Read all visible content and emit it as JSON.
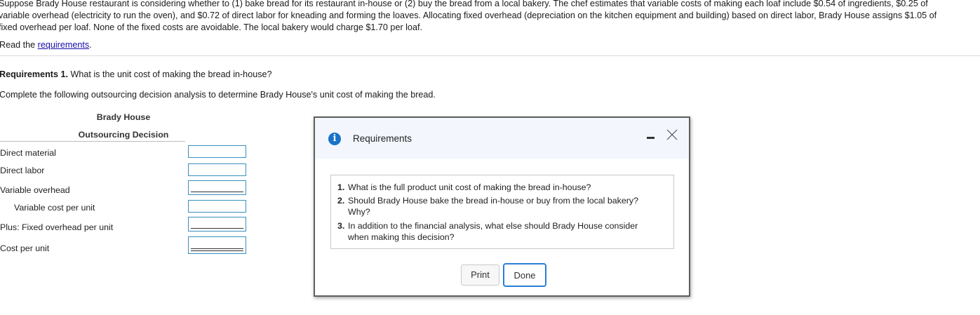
{
  "problem": {
    "line1": "Suppose Brady House restaurant is considering whether to (1) bake bread for its restaurant in-house or (2) buy the bread from a local bakery. The chef estimates that variable costs of making each loaf include $0.54 of ingredients, $0.25 of",
    "line2": "variable overhead (electricity to run the oven), and $0.72 of direct labor for kneading and forming the loaves. Allocating fixed overhead (depreciation on the kitchen equipment and building) based on direct labor, Brady House assigns $1.05 of",
    "line3": "fixed overhead per loaf. None of the fixed costs are avoidable. The local bakery would charge $1.70 per loaf."
  },
  "read": {
    "prefix": "Read the ",
    "link": "requirements",
    "suffix": "."
  },
  "requirement_prompt": {
    "bold": "Requirements 1.",
    "text": " What is the unit cost of making the bread in-house?"
  },
  "instruction": "Complete the following outsourcing decision analysis to determine Brady House's unit cost of making the bread.",
  "table": {
    "title1": "Brady House",
    "title2": "Outsourcing Decision",
    "rows": [
      {
        "label": "Direct material",
        "value": ""
      },
      {
        "label": "Direct labor",
        "value": ""
      },
      {
        "label": "Variable overhead",
        "value": ""
      },
      {
        "label": "Variable cost per unit",
        "value": ""
      },
      {
        "label": "Plus: Fixed overhead per unit",
        "value": ""
      },
      {
        "label": "Cost per unit",
        "value": ""
      }
    ]
  },
  "dialog": {
    "title": "Requirements",
    "info_icon": "i",
    "items": [
      {
        "num": "1.",
        "line1": "What is the full product unit cost of making the bread in-house?",
        "line2": ""
      },
      {
        "num": "2.",
        "line1": "Should Brady House bake the bread in-house or buy from the local bakery?",
        "line2": "Why?"
      },
      {
        "num": "3.",
        "line1": "In addition to the financial analysis, what else should Brady House consider",
        "line2": "when making this decision?"
      }
    ],
    "print_label": "Print",
    "done_label": "Done"
  }
}
